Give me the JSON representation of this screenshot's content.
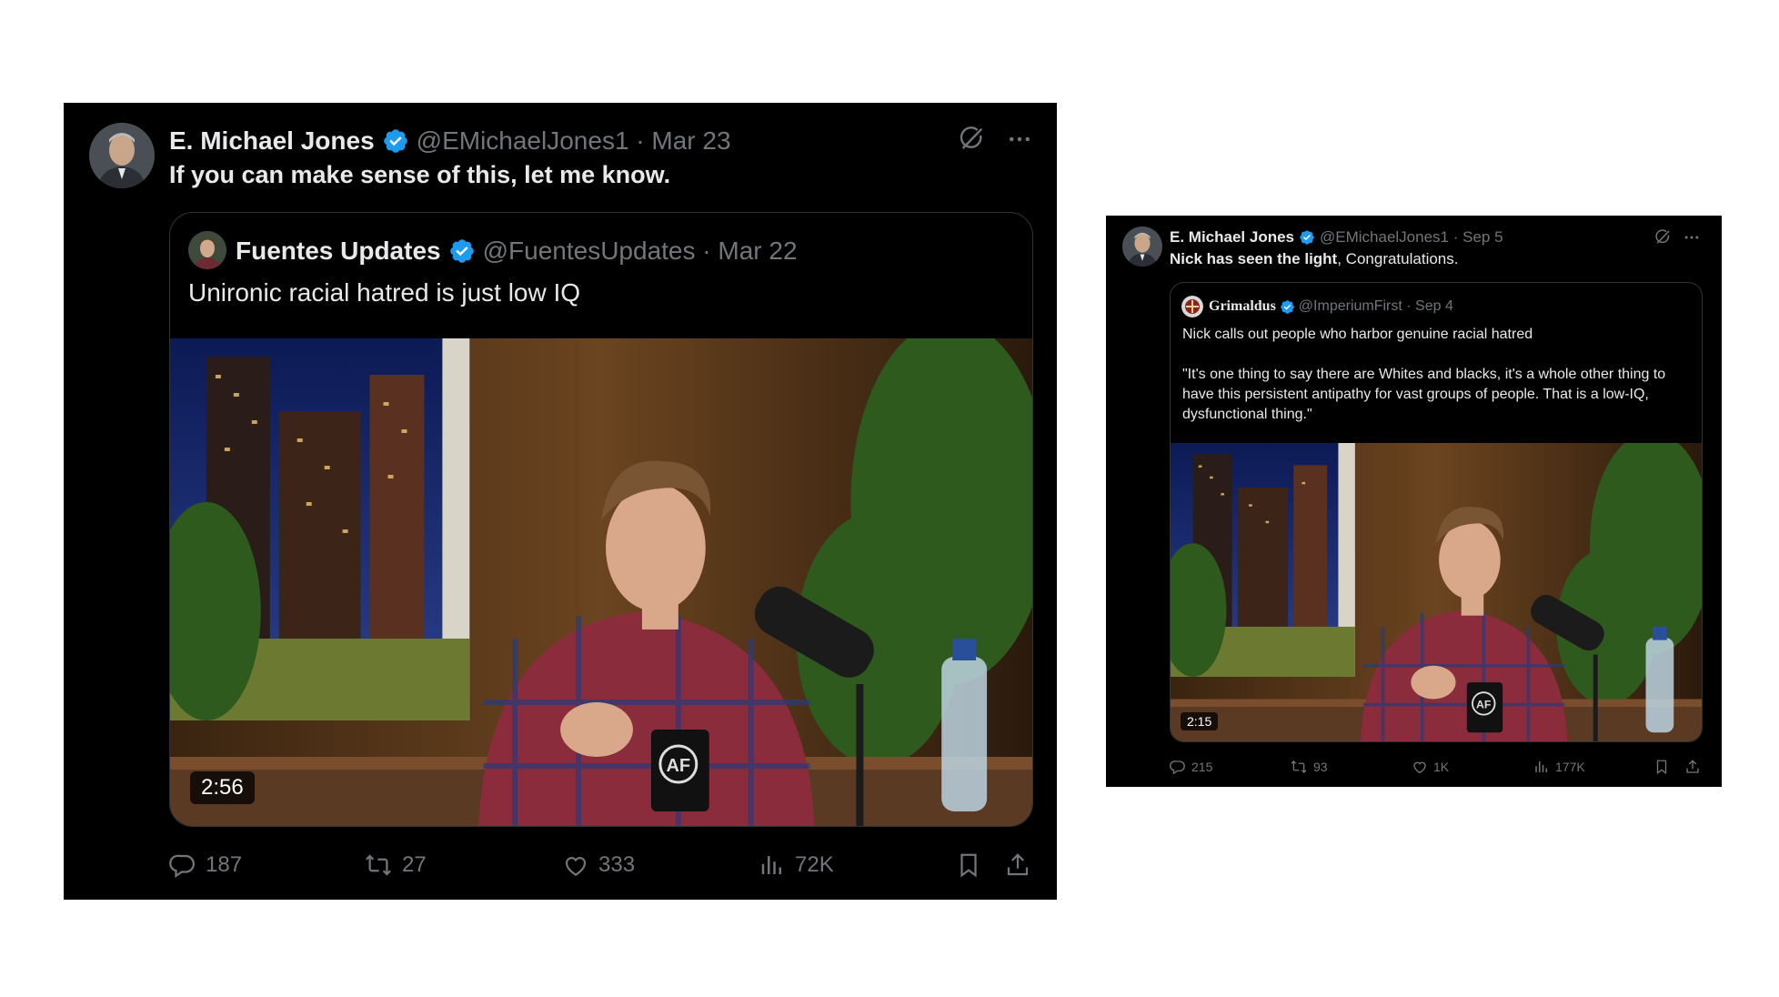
{
  "left_tweet": {
    "author_name": "E. Michael Jones",
    "author_meta": "@EMichaelJones1 · Mar 23",
    "text": "If you can make sense of this, let me know.",
    "quote": {
      "author_name": "Fuentes Updates",
      "author_meta": "@FuentesUpdates · Mar 22",
      "text": "Unironic racial hatred is just low IQ",
      "video_duration": "2:56"
    },
    "actions": {
      "replies": "187",
      "reposts": "27",
      "likes": "333",
      "views": "72K"
    }
  },
  "right_tweet": {
    "author_name": "E. Michael Jones",
    "author_meta": "@EMichaelJones1 · Sep 5",
    "text_bold": "Nick has seen the light",
    "text_rest": ", Congratulations.",
    "quote": {
      "author_name": "Grimaldus",
      "author_meta": "@ImperiumFirst · Sep 4",
      "text_line1": "Nick calls out people who harbor genuine racial hatred",
      "text_line2": "\"It's one thing to say there are Whites and blacks, it's a whole other thing to have this persistent antipathy for vast groups of people. That is a low-IQ, dysfunctional thing.\"",
      "video_duration": "2:15"
    },
    "actions": {
      "replies": "215",
      "reposts": "93",
      "likes": "1K",
      "views": "177K"
    }
  },
  "colors": {
    "background": "#ffffff",
    "tweet_bg": "#000000",
    "text_primary": "#e7e9ea",
    "text_muted": "#71767b",
    "verified_badge": "#1d9bf0",
    "border": "#2f3336"
  },
  "icons": [
    "grok-icon",
    "more-icon",
    "reply-icon",
    "repost-icon",
    "like-icon",
    "views-icon",
    "bookmark-icon",
    "share-icon",
    "verified-badge-icon"
  ]
}
